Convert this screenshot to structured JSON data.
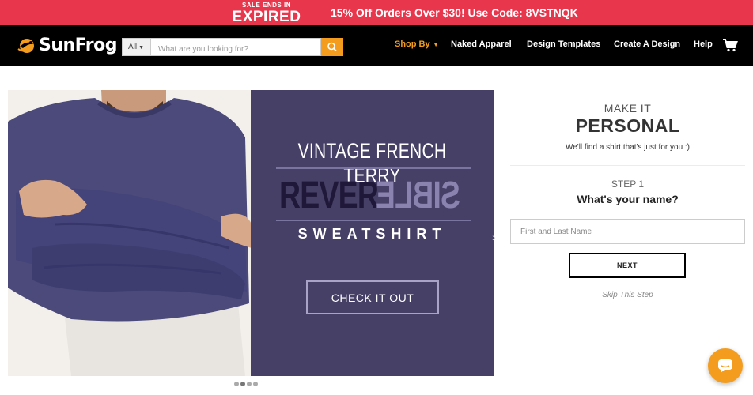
{
  "promo": {
    "sale_top": "SALE ENDS IN",
    "sale_status": "EXPIRED",
    "offer_text": "15% Off Orders Over $30! Use Code: 8VSTNQK"
  },
  "header": {
    "logo_text": "SunFrog",
    "search": {
      "category": "All",
      "placeholder": "What are you looking for?"
    },
    "nav": {
      "shop_by": "Shop By",
      "naked_apparel": "Naked Apparel",
      "design_templates": "Design Templates",
      "create_design": "Create A Design",
      "help": "Help"
    }
  },
  "hero": {
    "headline": "VINTAGE FRENCH TERRY",
    "rev_left": "REVER",
    "rev_right": "SIBLE",
    "product": "SWEATSHIRT",
    "cta": "CHECK IT OUT",
    "slide_count": 4,
    "active_slide": 2
  },
  "personalize": {
    "make_it": "MAKE IT",
    "personal": "PERSONAL",
    "tagline": "We'll find a shirt that's just for you :)",
    "step": "STEP 1",
    "question": "What's your name?",
    "name_placeholder": "First and Last Name",
    "next": "NEXT",
    "skip": "Skip This Step"
  },
  "colors": {
    "promo_red": "#e8374c",
    "accent_orange": "#f39c1d",
    "hero_purple": "#463f66"
  }
}
